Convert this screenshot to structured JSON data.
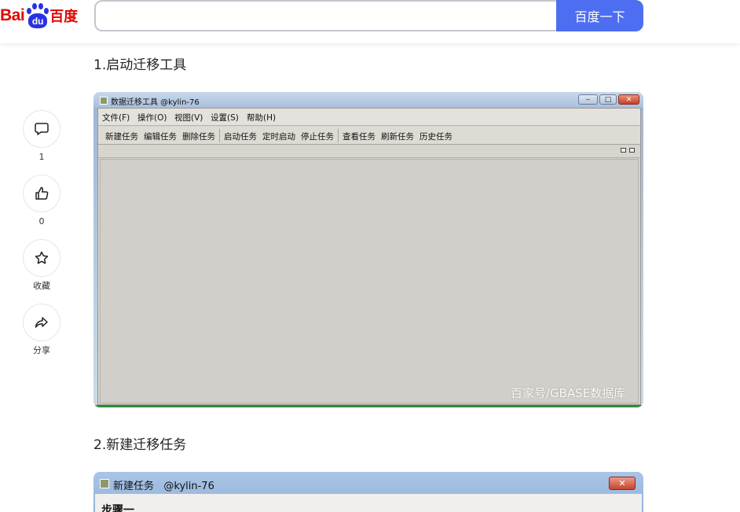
{
  "header": {
    "logo": {
      "latin": "Bai",
      "paw_text": "du",
      "chinese": "百度"
    },
    "search": {
      "value": "",
      "placeholder": "",
      "button_label": "百度一下"
    }
  },
  "side_actions": [
    {
      "icon": "comment-icon",
      "label": "1"
    },
    {
      "icon": "thumbs-up-icon",
      "label": "0"
    },
    {
      "icon": "star-icon",
      "label": "收藏"
    },
    {
      "icon": "share-icon",
      "label": "分享"
    }
  ],
  "article": {
    "heading1": "1.启动迁移工具",
    "heading2": "2.新建迁移任务",
    "screenshot1": {
      "window_title": "数据迁移工具 @kylin-76",
      "window_buttons": {
        "minimize": "‒",
        "maximize": "□",
        "close": "✕"
      },
      "menu": [
        "文件(F)",
        "操作(O)",
        "视图(V)",
        "设置(S)",
        "帮助(H)"
      ],
      "toolbar_groups": [
        [
          "新建任务",
          "编辑任务",
          "删除任务"
        ],
        [
          "启动任务",
          "定时启动",
          "停止任务"
        ],
        [
          "查看任务",
          "刷新任务",
          "历史任务"
        ]
      ],
      "watermark": "百家号/GBASE数据库"
    },
    "screenshot2": {
      "window_title": "新建任务   @kylin-76",
      "close": "✕",
      "step_label": "步骤一"
    }
  },
  "colors": {
    "brand_red": "#e10602",
    "brand_blue": "#2932e1",
    "search_button": "#4e6ef2"
  }
}
